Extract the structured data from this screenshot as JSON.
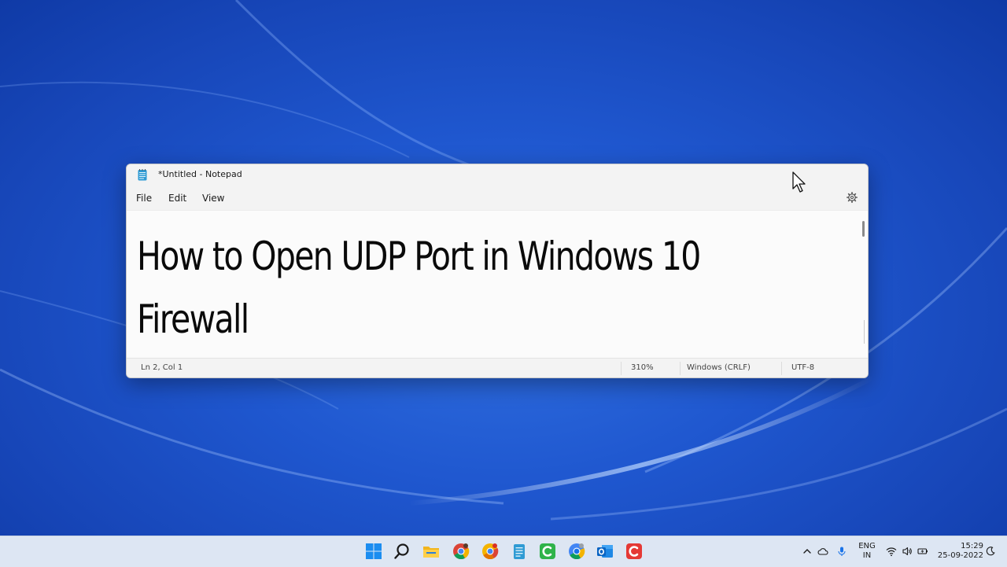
{
  "window": {
    "title": "*Untitled - Notepad",
    "menu": [
      "File",
      "Edit",
      "View"
    ],
    "content": "How to Open UDP Port in Windows 10\nFirewall"
  },
  "statusbar": {
    "position": "Ln 2, Col 1",
    "zoom": "310%",
    "line_ending": "Windows (CRLF)",
    "encoding": "UTF-8"
  },
  "taskbar": {
    "icons": [
      "windows-start-icon",
      "search-icon",
      "file-explorer-icon",
      "chrome-icon",
      "chrome-canary-icon",
      "notepad-icon",
      "camtasia-icon",
      "chrome-dev-icon",
      "outlook-icon",
      "camtasia-recorder-icon"
    ],
    "tray": {
      "language_line1": "ENG",
      "language_line2": "IN",
      "time": "15:29",
      "date": "25-09-2022"
    }
  },
  "colors": {
    "wallpaper": "#1f57cf",
    "taskbar": "#dde6f3",
    "window_bg": "#f9f9f9"
  }
}
